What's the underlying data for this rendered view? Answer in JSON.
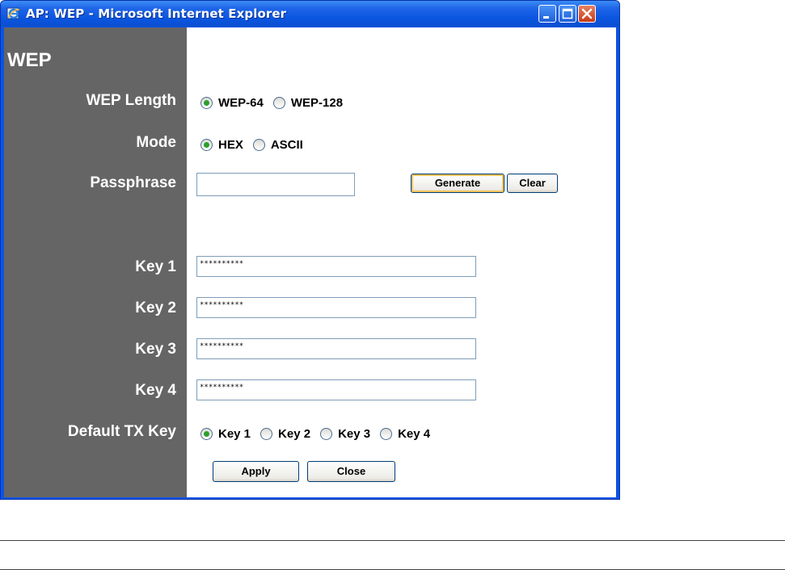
{
  "window": {
    "title": "AP: WEP - Microsoft Internet Explorer"
  },
  "form": {
    "heading": "WEP",
    "wep_length": {
      "label": "WEP Length",
      "options": [
        "WEP-64",
        "WEP-128"
      ],
      "selected": "WEP-64"
    },
    "mode": {
      "label": "Mode",
      "options": [
        "HEX",
        "ASCII"
      ],
      "selected": "HEX"
    },
    "passphrase": {
      "label": "Passphrase",
      "value": "",
      "generate_label": "Generate",
      "clear_label": "Clear"
    },
    "keys": [
      {
        "label": "Key 1",
        "value": "**********"
      },
      {
        "label": "Key 2",
        "value": "**********"
      },
      {
        "label": "Key 3",
        "value": "**********"
      },
      {
        "label": "Key 4",
        "value": "**********"
      }
    ],
    "default_tx_key": {
      "label": "Default TX Key",
      "options": [
        "Key 1",
        "Key 2",
        "Key 3",
        "Key 4"
      ],
      "selected": "Key 1"
    },
    "apply_label": "Apply",
    "close_label": "Close"
  },
  "colors": {
    "titlebar": "#0a55df",
    "label_column": "#656565",
    "radio_checked": "#2b9f2b"
  }
}
